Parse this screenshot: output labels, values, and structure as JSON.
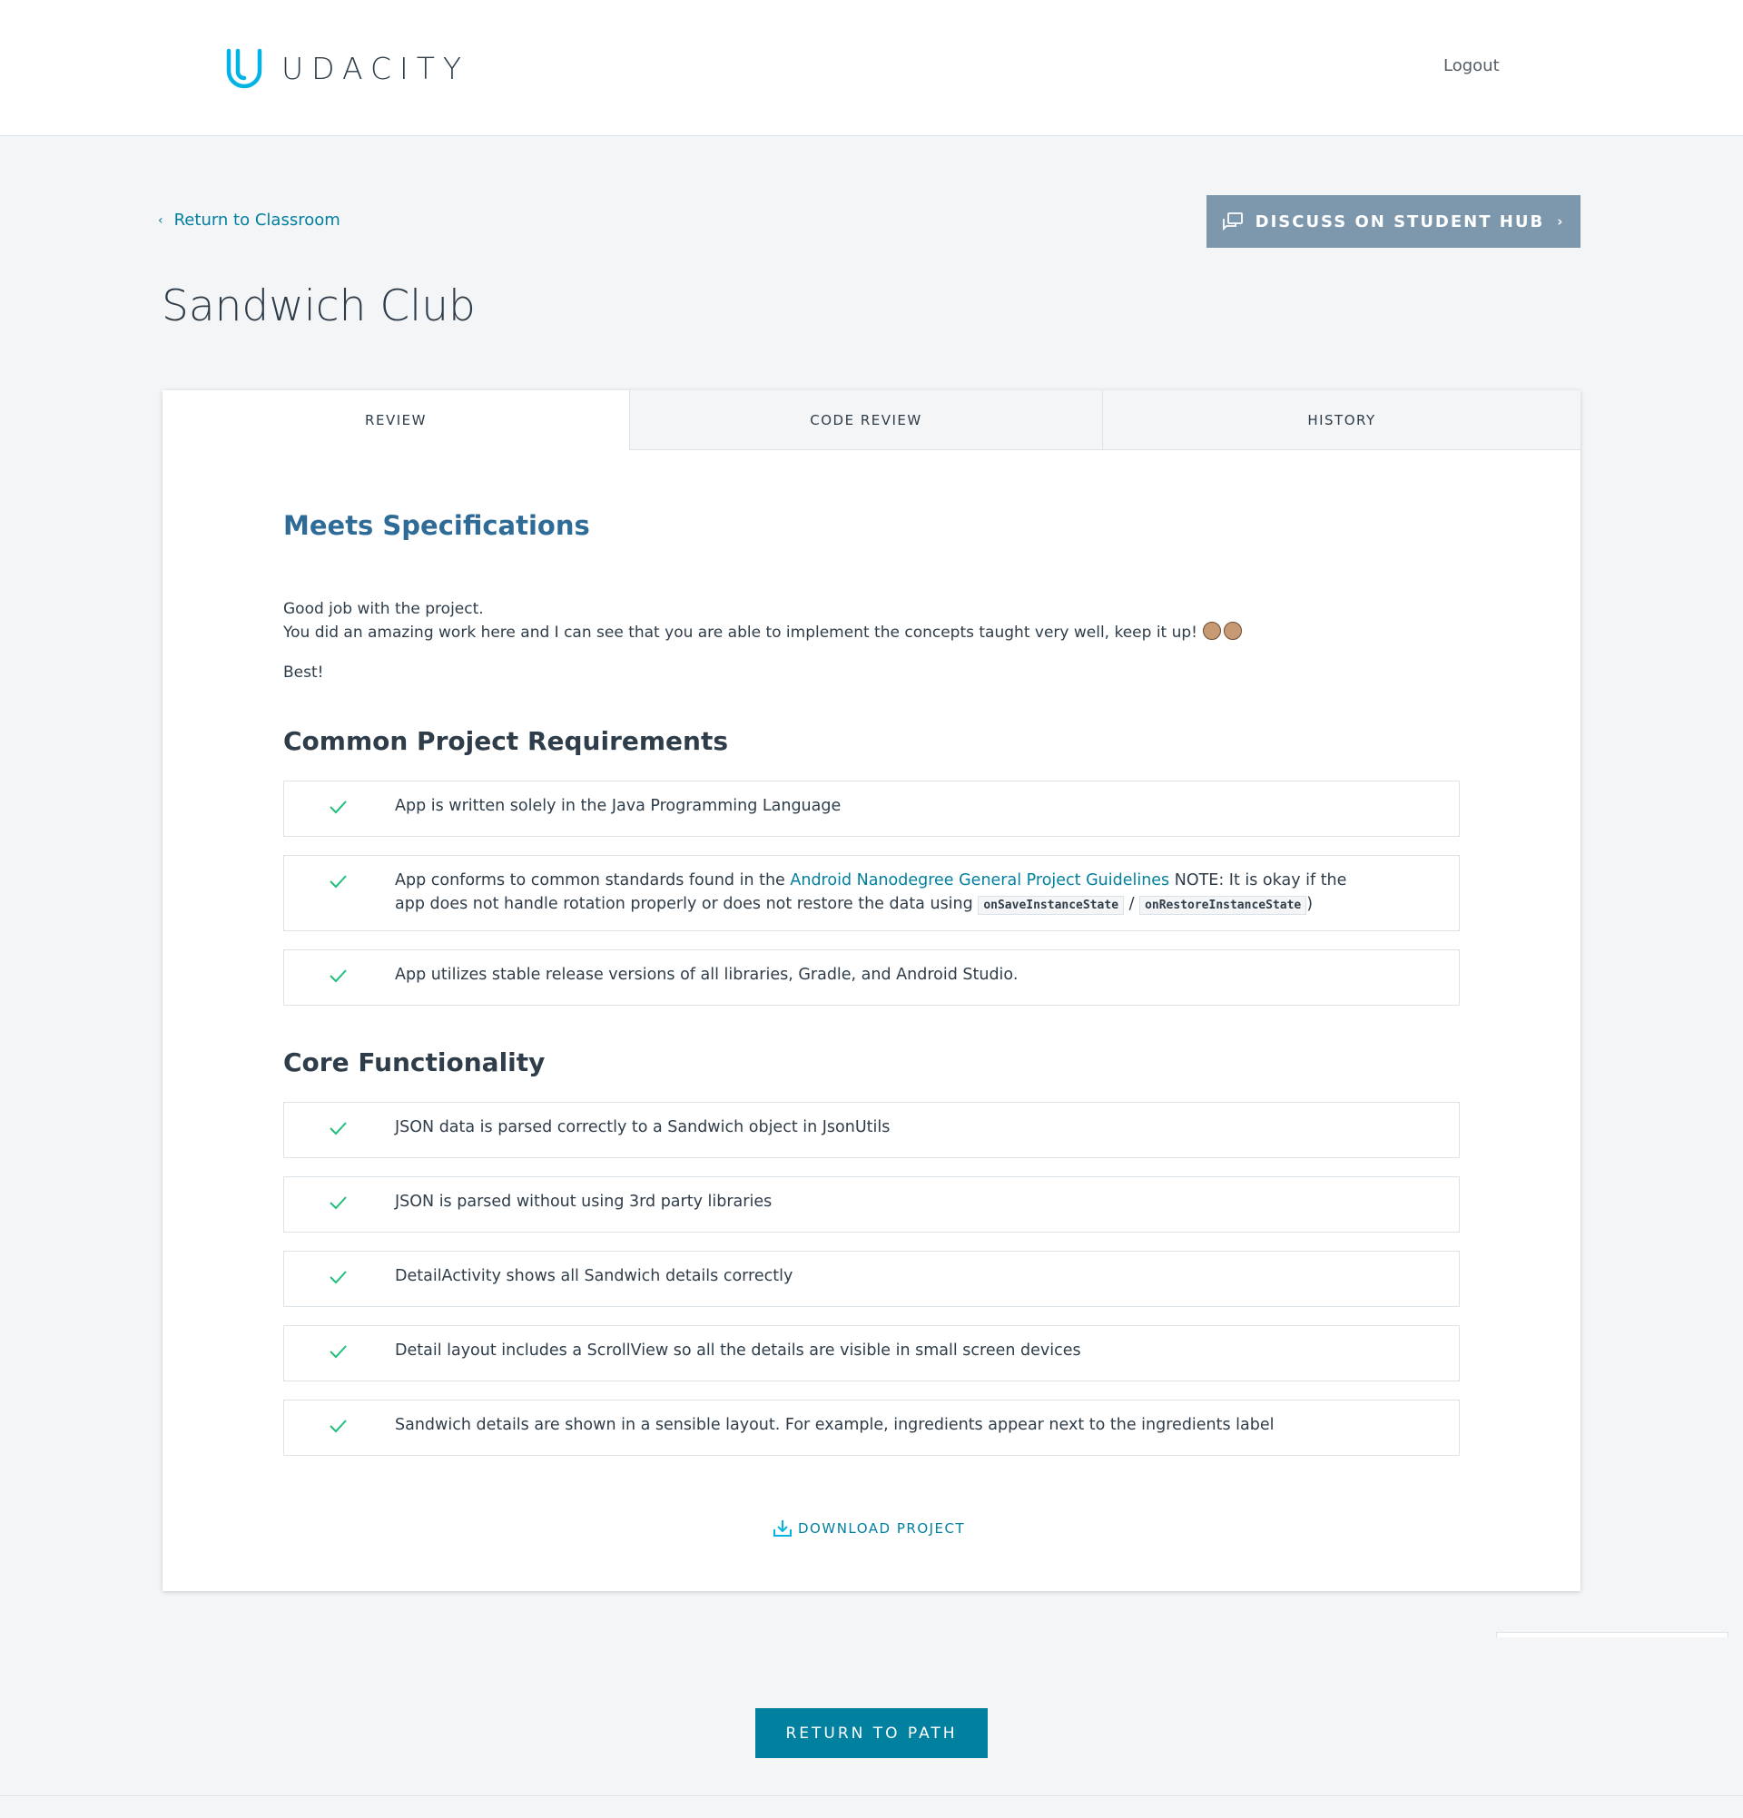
{
  "header": {
    "brand": "UDACITY",
    "logout_label": "Logout"
  },
  "nav": {
    "return_label": "Return to Classroom",
    "discuss_label": "DISCUSS ON STUDENT HUB"
  },
  "page": {
    "title": "Sandwich Club"
  },
  "tabs": [
    {
      "label": "REVIEW",
      "active": true
    },
    {
      "label": "CODE REVIEW",
      "active": false
    },
    {
      "label": "HISTORY",
      "active": false
    }
  ],
  "review": {
    "status": "Meets Specifications",
    "summary_line1": "Good job with the project.",
    "summary_line2": "You did an amazing work here and I can see that you are able to implement the concepts taught very well, keep it up!",
    "summary_sign": "Best!",
    "sections": [
      {
        "title": "Common Project Requirements",
        "items": [
          {
            "text": "App is written solely in the Java Programming Language"
          },
          {
            "text_before": "App conforms to common standards found in the ",
            "link": "Android Nanodegree General Project Guidelines",
            "text_after": " NOTE: It is okay if the app does not handle rotation properly or does not restore the data using ",
            "code1": "onSaveInstanceState",
            "sep": " / ",
            "code2": "onRestoreInstanceState",
            "end": ")"
          },
          {
            "text": "App utilizes stable release versions of all libraries, Gradle, and Android Studio."
          }
        ]
      },
      {
        "title": "Core Functionality",
        "items": [
          {
            "text": "JSON data is parsed correctly to a Sandwich object in JsonUtils"
          },
          {
            "text": "JSON is parsed without using 3rd party libraries"
          },
          {
            "text": "DetailActivity shows all Sandwich details correctly"
          },
          {
            "text": "Detail layout includes a ScrollView so all the details are visible in small screen devices"
          },
          {
            "text": "Sandwich details are shown in a sensible layout. For example, ingredients appear next to the ingredients label"
          }
        ]
      }
    ],
    "download_label": "DOWNLOAD PROJECT"
  },
  "footer": {
    "return_path_label": "RETURN TO PATH"
  },
  "colors": {
    "accent": "#02809f",
    "heading_blue": "#2e6b96",
    "check_green": "#02b3e4",
    "discuss_bg": "#7d97ad",
    "text": "#2e3d49"
  }
}
